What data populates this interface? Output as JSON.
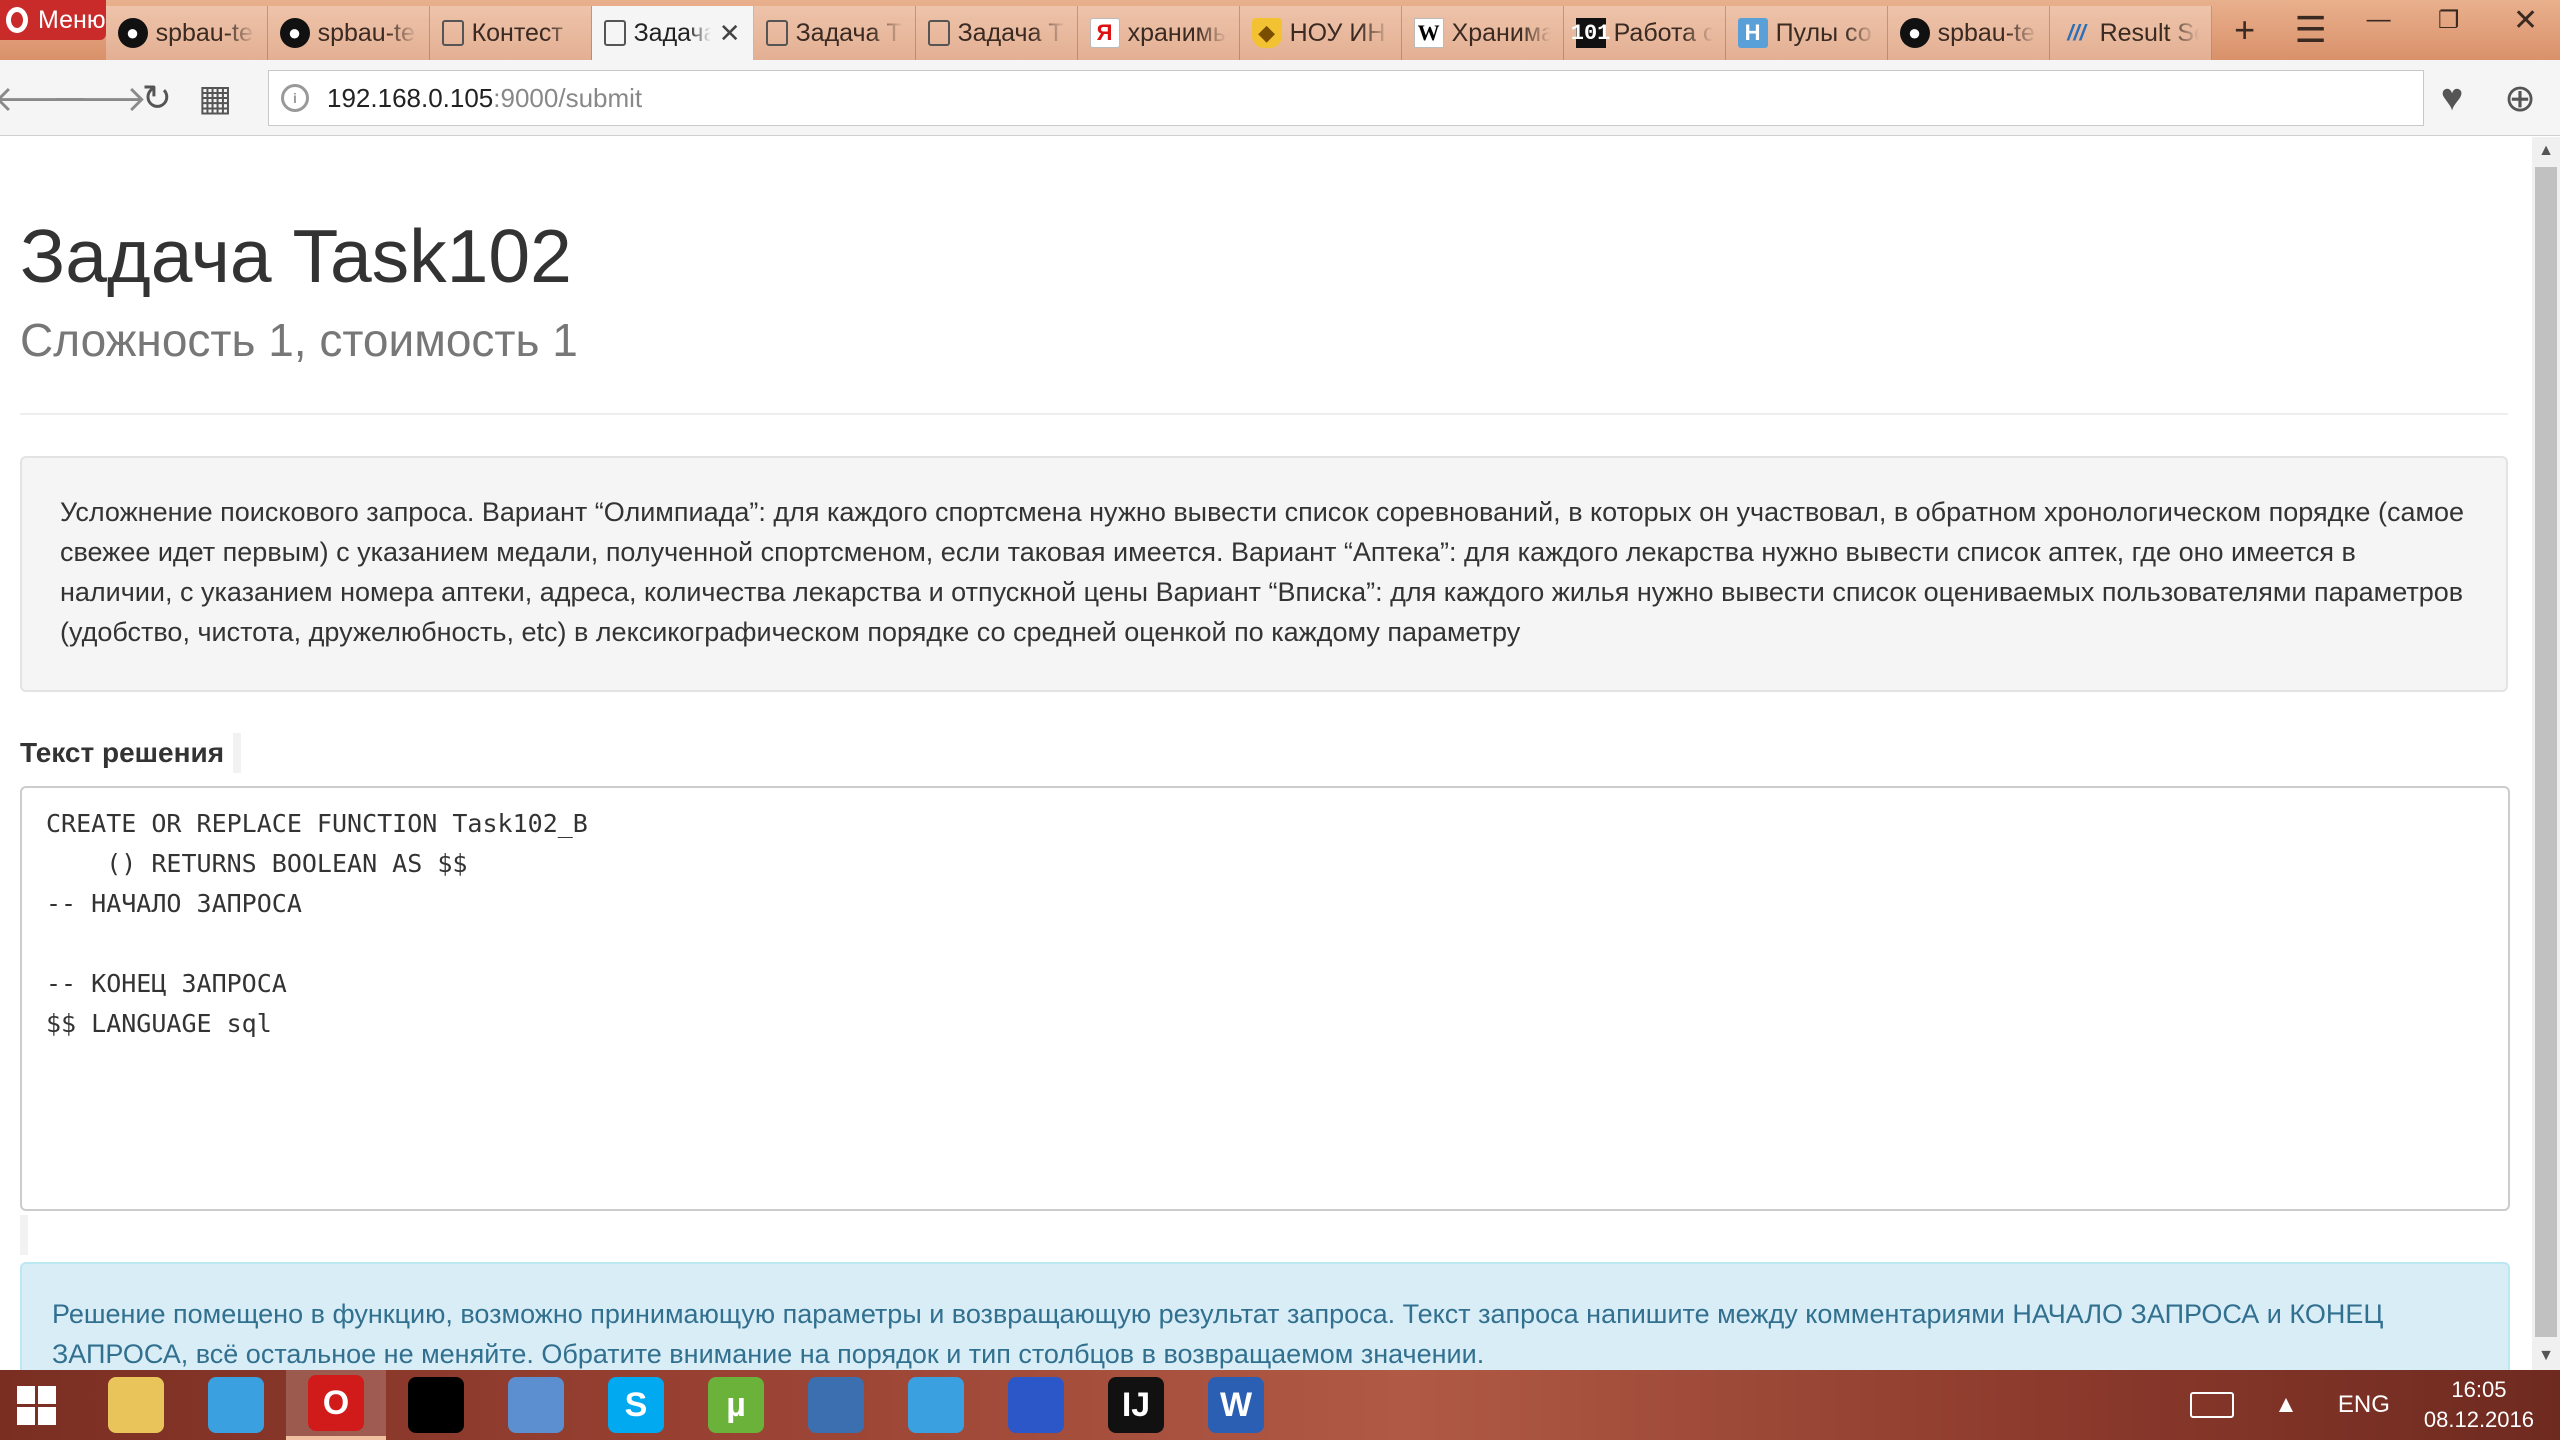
{
  "browser": {
    "menu_label": "Меню",
    "tabs": [
      {
        "label": "spbau-te",
        "icon": "github-icon",
        "glyph": "●"
      },
      {
        "label": "spbau-te",
        "icon": "github-icon",
        "glyph": "●"
      },
      {
        "label": "Контест",
        "icon": "document-icon",
        "glyph": ""
      },
      {
        "label": "Задача",
        "icon": "document-icon",
        "glyph": "",
        "active": true
      },
      {
        "label": "Задача Т",
        "icon": "document-icon",
        "glyph": ""
      },
      {
        "label": "Задача Т",
        "icon": "document-icon",
        "glyph": ""
      },
      {
        "label": "хранимы",
        "icon": "yandex-icon",
        "glyph": "Я"
      },
      {
        "label": "НОУ ИН",
        "icon": "shield-icon",
        "glyph": "◆"
      },
      {
        "label": "Хранима",
        "icon": "wikipedia-icon",
        "glyph": "W"
      },
      {
        "label": "Работа с",
        "icon": "binary-icon",
        "glyph": "101"
      },
      {
        "label": "Пулы со",
        "icon": "h-icon",
        "glyph": "H"
      },
      {
        "label": "spbau-te",
        "icon": "github-icon",
        "glyph": "●"
      },
      {
        "label": "Result Se",
        "icon": "stripes-icon",
        "glyph": "///"
      }
    ],
    "close_tab_glyph": "✕",
    "new_tab_glyph": "+",
    "address": {
      "host": "192.168.0.105",
      "path": ":9000/submit"
    }
  },
  "page": {
    "title": "Задача Task102",
    "subtitle": "Сложность 1, стоимость 1",
    "description": "Усложнение поискового запроса. Вариант “Олимпиада”: для каждого спортсмена нужно вывести список соревнований, в которых он участвовал, в обратном хронологическом порядке (самое свежее идет первым) с указанием медали, полученной спортсменом, если таковая имеется. Вариант “Аптека”: для каждого лекарства нужно вывести список аптек, где оно имеется в наличии, с указанием номера аптеки, адреса, количества лекарства и отпускной цены Вариант “Вписка”: для каждого жилья нужно вывести список оцениваемых пользователями параметров (удобство, чистота, дружелюбность, etc) в лексикографическом порядке со средней оценкой по каждому параметру",
    "solution_label": "Текст решения",
    "solution_code": "CREATE OR REPLACE FUNCTION Task102_B\n    () RETURNS BOOLEAN AS $$\n-- НАЧАЛО ЗАПРОСА\n\n-- КОНЕЦ ЗАПРОСА\n$$ LANGUAGE sql",
    "info_text": "Решение помещено в функцию, возможно принимающую параметры и возвращающую результат запроса. Текст запроса напишите между комментариями НАЧАЛО ЗАПРОСА и КОНЕЦ ЗАПРОСА, всё остальное не меняйте. Обратите внимание на порядок и тип столбцов в возвращаемом значении."
  },
  "taskbar": {
    "apps": [
      {
        "name": "file-explorer",
        "glyph": "",
        "color": "#e8c45a"
      },
      {
        "name": "windows-logo-app",
        "glyph": "",
        "color": "#3aa0e0"
      },
      {
        "name": "opera",
        "glyph": "O",
        "color": "#d11a1a",
        "active": true
      },
      {
        "name": "terminal",
        "glyph": "",
        "color": "#000000"
      },
      {
        "name": "control-panel",
        "glyph": "",
        "color": "#5b8fd0"
      },
      {
        "name": "skype",
        "glyph": "S",
        "color": "#00a9f0"
      },
      {
        "name": "utorrent",
        "glyph": "µ",
        "color": "#6bb23a"
      },
      {
        "name": "virtualbox",
        "glyph": "",
        "color": "#3b6fb0"
      },
      {
        "name": "windows-logo-app-2",
        "glyph": "",
        "color": "#3aa0e0"
      },
      {
        "name": "eclipse",
        "glyph": "",
        "color": "#2b57c8"
      },
      {
        "name": "intellij",
        "glyph": "IJ",
        "color": "#111111"
      },
      {
        "name": "word",
        "glyph": "W",
        "color": "#2b5fb4"
      }
    ],
    "language": "ENG",
    "time": "16:05",
    "date": "08.12.2016"
  }
}
